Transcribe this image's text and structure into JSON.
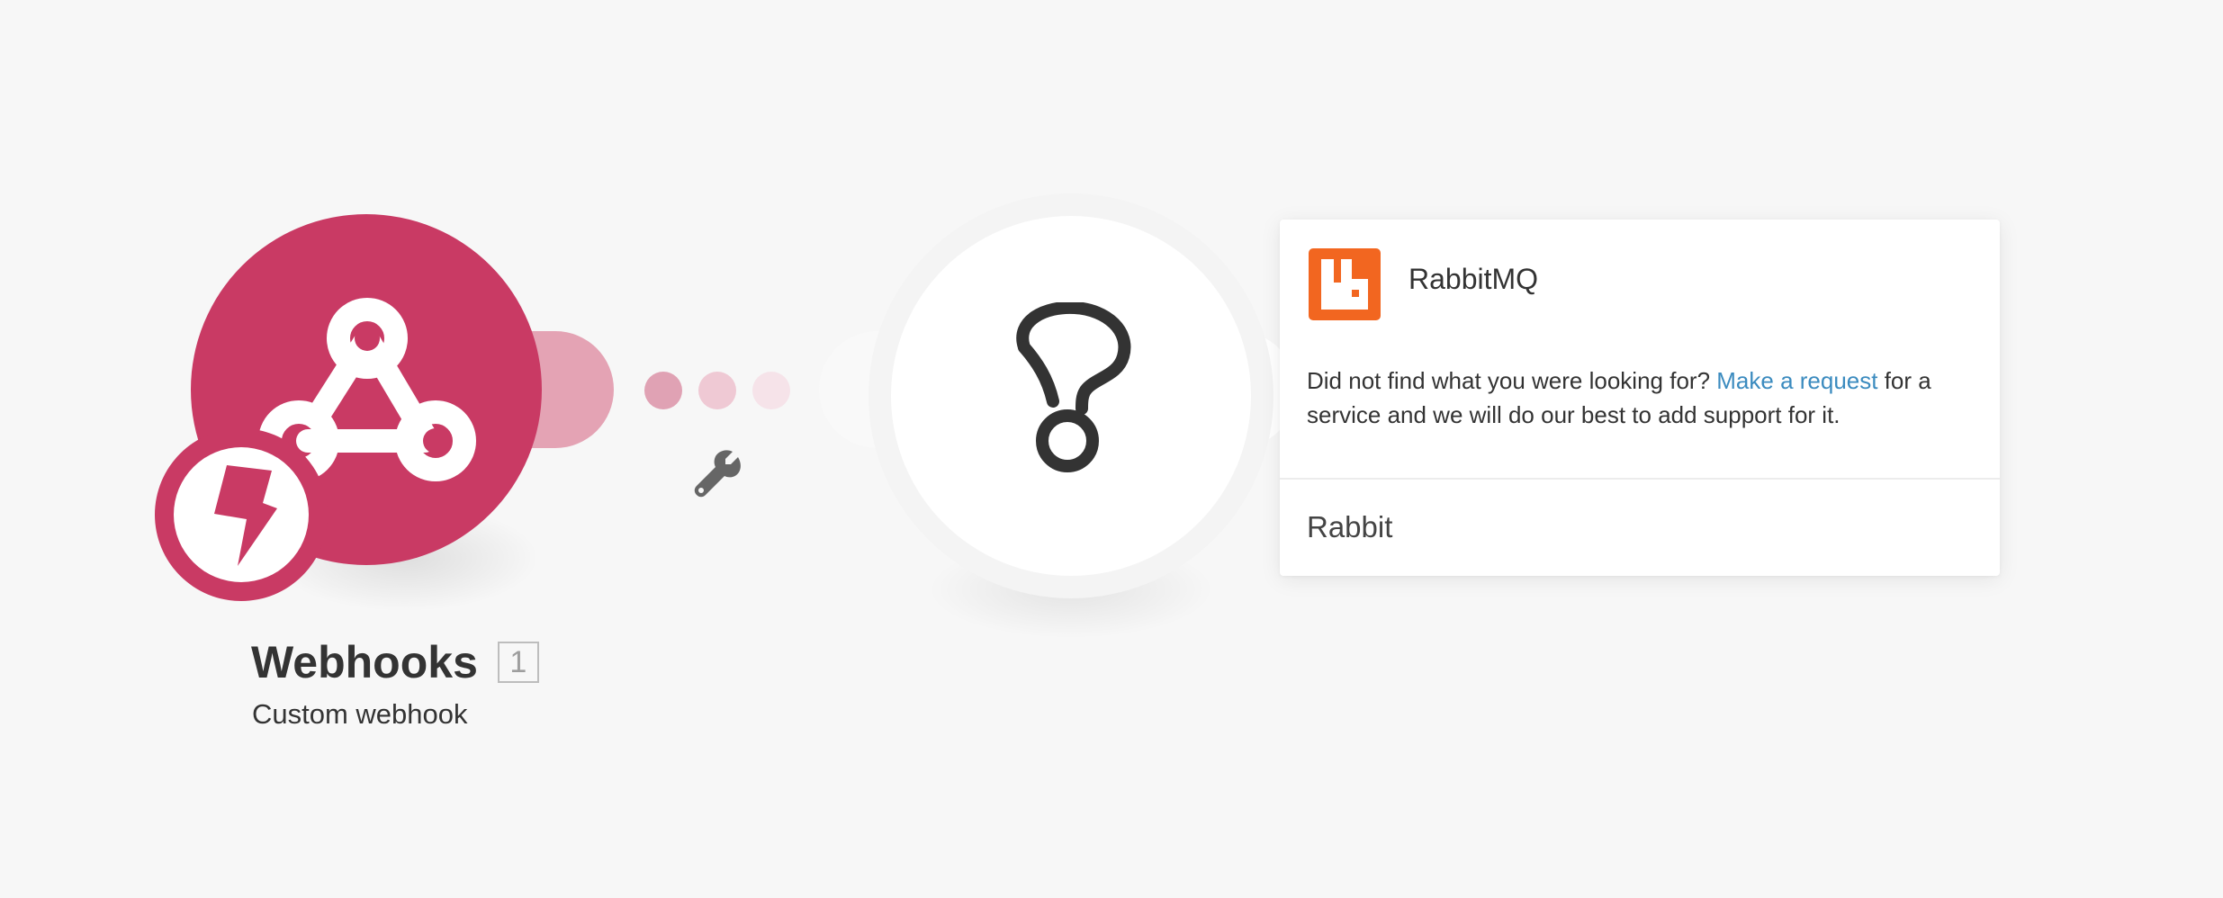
{
  "scenario": {
    "modules": [
      {
        "title": "Webhooks",
        "id": "1",
        "subtitle": "Custom webhook",
        "icon": "webhook-icon",
        "badge_icon": "bolt-icon",
        "color": "#c93a64"
      }
    ],
    "placeholder": {
      "icon": "question-mark-icon"
    },
    "route_tool_icon": "wrench-icon"
  },
  "app_search": {
    "results": [
      {
        "name": "RabbitMQ",
        "icon": "rabbitmq-logo-icon",
        "color": "#f26620"
      }
    ],
    "helper": {
      "prefix": "Did not find what you were looking for? ",
      "link": "Make a request",
      "suffix": " for a service and we will do our best to add support for it."
    },
    "link_color": "#3b8bbf",
    "query": "Rabbit"
  }
}
